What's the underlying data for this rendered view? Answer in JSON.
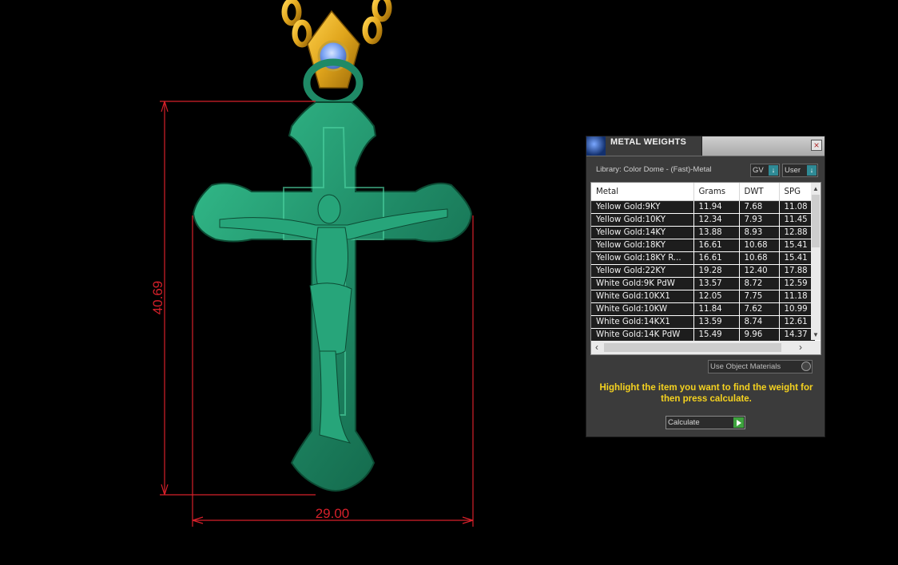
{
  "model_view": {
    "height_dimension": "40.69",
    "width_dimension": "29.00",
    "colors": {
      "background": "#000000",
      "dimension_lines": "#d6202a",
      "cross_metal": "#1f8a66",
      "bail_gold": "#e0a51c",
      "gemstone": "#7ea6f5"
    }
  },
  "panel": {
    "title": "METAL WEIGHTS",
    "close_label": "×",
    "library_label": "Library: Color Dome - (Fast)-Metal",
    "gv_label": "GV",
    "user_label": "User",
    "columns": [
      "Metal",
      "Grams",
      "DWT",
      "SPG"
    ],
    "rows": [
      [
        "Yellow Gold:9KY",
        "11.94",
        "7.68",
        "11.08"
      ],
      [
        "Yellow Gold:10KY",
        "12.34",
        "7.93",
        "11.45"
      ],
      [
        "Yellow Gold:14KY",
        "13.88",
        "8.93",
        "12.88"
      ],
      [
        "Yellow Gold:18KY",
        "16.61",
        "10.68",
        "15.41"
      ],
      [
        "Yellow Gold:18KY R...",
        "16.61",
        "10.68",
        "15.41"
      ],
      [
        "Yellow Gold:22KY",
        "19.28",
        "12.40",
        "17.88"
      ],
      [
        "White Gold:9K PdW",
        "13.57",
        "8.72",
        "12.59"
      ],
      [
        "White Gold:10KX1",
        "12.05",
        "7.75",
        "11.18"
      ],
      [
        "White Gold:10KW",
        "11.84",
        "7.62",
        "10.99"
      ],
      [
        "White Gold:14KX1",
        "13.59",
        "8.74",
        "12.61"
      ],
      [
        "White Gold:14K PdW",
        "15.49",
        "9.96",
        "14.37"
      ]
    ],
    "use_object_materials_label": "Use Object Materials",
    "instruction_text": "Highlight the item you want to find the weight for then press calculate.",
    "calculate_label": "Calculate",
    "colors": {
      "panel_bg": "#3b3b3b",
      "row_bg": "#1d1d1d",
      "instruction_text": "#f5d21f",
      "accent_button": "#2f8a95",
      "calculate_icon": "#3ea33e"
    }
  }
}
